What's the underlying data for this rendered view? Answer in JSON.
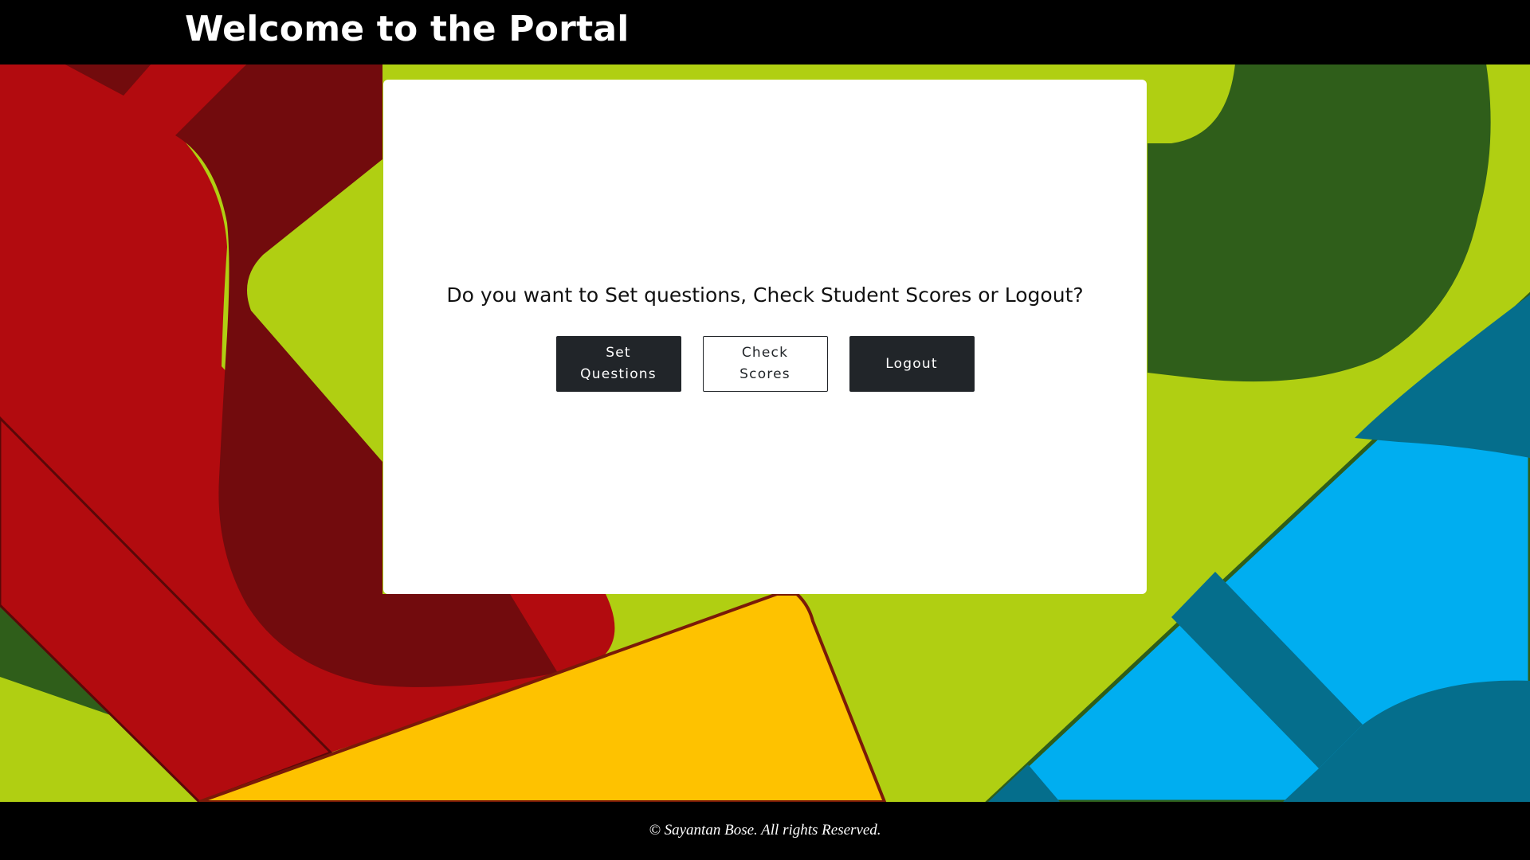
{
  "header": {
    "title": "Welcome to the Portal"
  },
  "main": {
    "prompt": "Do you want to Set questions, Check Student Scores or Logout?",
    "buttons": {
      "set_questions": "Set Questions",
      "check_scores": "Check Scores",
      "logout": "Logout"
    }
  },
  "footer": {
    "copyright": "© Sayantan Bose. All rights Reserved."
  },
  "colors": {
    "header_bg": "#000000",
    "footer_bg": "#000000",
    "button_dark": "#212529",
    "bg_lime": "#b0cf12",
    "bg_red": "#b20b0f",
    "bg_dark_red": "#720b0d",
    "bg_dark_green": "#2f5e1a",
    "bg_yellow": "#fec200",
    "bg_blue": "#00aef0",
    "bg_teal": "#056e8c"
  }
}
